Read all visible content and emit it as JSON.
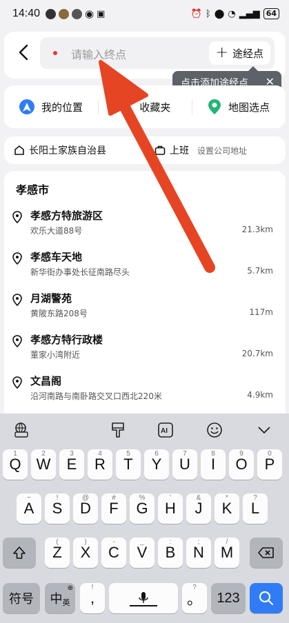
{
  "status_bar": {
    "time": "14:40",
    "battery": "64"
  },
  "search": {
    "placeholder": "请输入终点",
    "waypoint_label": "途经点"
  },
  "tooltip": {
    "text": "点击添加途经点"
  },
  "quick_options": [
    {
      "label": "我的位置",
      "icon": "navigation-arrow-icon",
      "color": "#2f7cf6"
    },
    {
      "label": "收藏夹",
      "icon": "star-icon",
      "color": "#f5b400"
    },
    {
      "label": "地图选点",
      "icon": "map-pin-icon",
      "color": "#22b573"
    }
  ],
  "shortcuts": {
    "home_label": "长阳土家族自治县",
    "work_label": "上班",
    "work_sub": "设置公司地址"
  },
  "results": {
    "city": "孝感市",
    "items": [
      {
        "name": "孝感方特旅游区",
        "address": "欢乐大道88号",
        "distance": "21.3km"
      },
      {
        "name": "孝感车天地",
        "address": "新华街办事处长征南路尽头",
        "distance": "5.7km"
      },
      {
        "name": "月湖警苑",
        "address": "黄陂东路208号",
        "distance": "117m"
      },
      {
        "name": "孝感方特行政楼",
        "address": "董家小湾附近",
        "distance": "20.7km"
      },
      {
        "name": "文昌阁",
        "address": "沿河南路与南卧路交叉口西北220米",
        "distance": "4.9km"
      }
    ]
  },
  "keyboard": {
    "row1": [
      {
        "k": "Q",
        "n": "1"
      },
      {
        "k": "W",
        "n": "2"
      },
      {
        "k": "E",
        "n": "3"
      },
      {
        "k": "R",
        "n": "4"
      },
      {
        "k": "T",
        "n": "5"
      },
      {
        "k": "Y",
        "n": "6"
      },
      {
        "k": "U",
        "n": "7"
      },
      {
        "k": "I",
        "n": "8"
      },
      {
        "k": "O",
        "n": "9"
      },
      {
        "k": "P",
        "n": "0"
      }
    ],
    "row2": [
      {
        "k": "A",
        "n": "~"
      },
      {
        "k": "S",
        "n": "!"
      },
      {
        "k": "D",
        "n": "@"
      },
      {
        "k": "F",
        "n": "#"
      },
      {
        "k": "G",
        "n": "%"
      },
      {
        "k": "H",
        "n": "'"
      },
      {
        "k": "J",
        "n": "&"
      },
      {
        "k": "K",
        "n": "*"
      },
      {
        "k": "L",
        "n": "?"
      }
    ],
    "row3": [
      {
        "k": "Z",
        "n": "("
      },
      {
        "k": "X",
        "n": ")"
      },
      {
        "k": "C",
        "n": "-"
      },
      {
        "k": "V",
        "n": "_"
      },
      {
        "k": "B",
        "n": ":"
      },
      {
        "k": "N",
        "n": ";"
      },
      {
        "k": "M",
        "n": "/"
      }
    ],
    "symbols_label": "符号",
    "lang_label": "中",
    "lang_sub": "英",
    "comma_label": ",",
    "comma_sub": "!",
    "period_label": "。",
    "period_sub": "?",
    "numbers_label": "123"
  }
}
